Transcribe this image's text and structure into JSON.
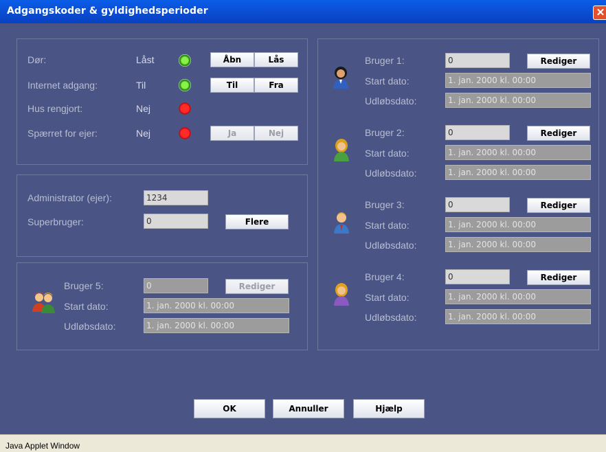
{
  "window": {
    "title": "Adgangskoder & gyldighedsperioder",
    "close": "✕"
  },
  "status": {
    "rows": [
      {
        "label": "Dør:",
        "value": "Låst",
        "led": "green",
        "btn1": "Åbn",
        "btn2": "Lås",
        "disabled": false
      },
      {
        "label": "Internet adgang:",
        "value": "Til",
        "led": "green",
        "btn1": "Til",
        "btn2": "Fra",
        "disabled": false
      },
      {
        "label": "Hus rengjort:",
        "value": "Nej",
        "led": "red"
      },
      {
        "label": "Spærret for ejer:",
        "value": "Nej",
        "led": "red",
        "btn1": "Ja",
        "btn2": "Nej",
        "disabled": true
      }
    ]
  },
  "admin": {
    "admin_label": "Administrator (ejer):",
    "admin_value": "1234",
    "super_label": "Superbruger:",
    "super_value": "0",
    "more_button": "Flere"
  },
  "user5": {
    "label": "Bruger 5:",
    "value": "0",
    "edit": "Rediger",
    "start_label": "Start dato:",
    "start_value": "1. jan. 2000 kl. 00:00",
    "end_label": "Udløbsdato:",
    "end_value": "1. jan. 2000 kl. 00:00"
  },
  "users": [
    {
      "label": "Bruger 1:",
      "value": "0",
      "edit": "Rediger",
      "start_label": "Start dato:",
      "start_value": "1. jan. 2000 kl. 00:00",
      "end_label": "Udløbsdato:",
      "end_value": "1. jan. 2000 kl. 00:00"
    },
    {
      "label": "Bruger 2:",
      "value": "0",
      "edit": "Rediger",
      "start_label": "Start dato:",
      "start_value": "1. jan. 2000 kl. 00:00",
      "end_label": "Udløbsdato:",
      "end_value": "1. jan. 2000 kl. 00:00"
    },
    {
      "label": "Bruger 3:",
      "value": "0",
      "edit": "Rediger",
      "start_label": "Start dato:",
      "start_value": "1. jan. 2000 kl. 00:00",
      "end_label": "Udløbsdato:",
      "end_value": "1. jan. 2000 kl. 00:00"
    },
    {
      "label": "Bruger 4:",
      "value": "0",
      "edit": "Rediger",
      "start_label": "Start dato:",
      "start_value": "1. jan. 2000 kl. 00:00",
      "end_label": "Udløbsdato:",
      "end_value": "1. jan. 2000 kl. 00:00"
    }
  ],
  "footer": {
    "ok": "OK",
    "cancel": "Annuller",
    "help": "Hjælp"
  },
  "statusbar": {
    "text": "Java Applet Window"
  },
  "colors": {
    "background": "#4b5585",
    "titlebar": "#0b4fd6",
    "led_on": "#5fd02a",
    "led_off": "#ff2020"
  }
}
